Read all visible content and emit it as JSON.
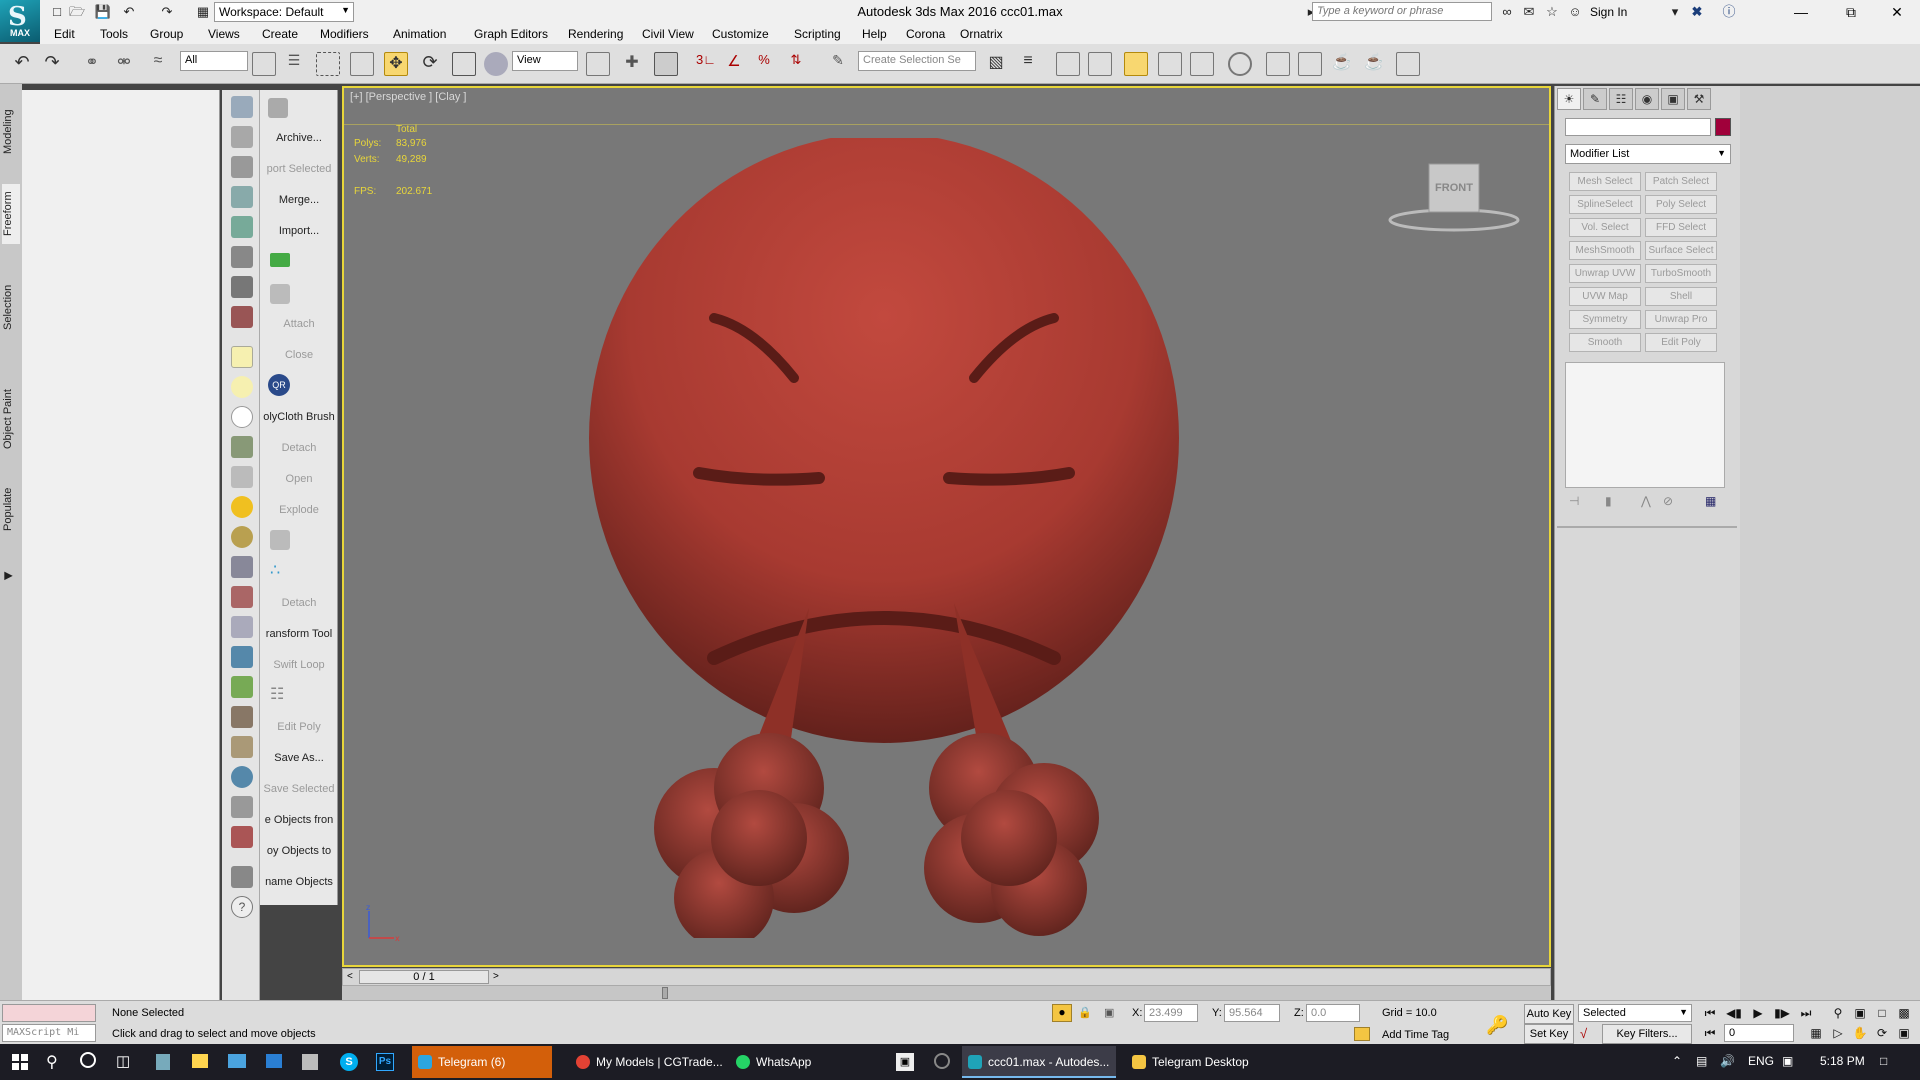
{
  "titlebar": {
    "workspace": "Workspace: Default",
    "title": "Autodesk 3ds Max 2016     ccc01.max",
    "search_placeholder": "Type a keyword or phrase",
    "sign_in": "Sign In",
    "logo_text": "MAX"
  },
  "menubar": [
    "Edit",
    "Tools",
    "Group",
    "Views",
    "Create",
    "Modifiers",
    "Animation",
    "Graph Editors",
    "Rendering",
    "Civil View",
    "Customize",
    "Scripting",
    "Help",
    "Corona",
    "Ornatrix"
  ],
  "toolbar": {
    "selection_filter": "All",
    "ref_coord": "View",
    "selection_set_placeholder": "Create Selection Se"
  },
  "ribbon_tabs": [
    "Modeling",
    "Freeform",
    "Selection",
    "Object Paint",
    "Populate"
  ],
  "left_labels": [
    {
      "text": "Archive...",
      "enabled": true
    },
    {
      "text": "port Selected",
      "enabled": false
    },
    {
      "text": "Merge...",
      "enabled": true
    },
    {
      "text": "Import...",
      "enabled": true
    },
    {
      "text": "Attach",
      "enabled": false
    },
    {
      "text": "Close",
      "enabled": false
    },
    {
      "text": "olyCloth Brush",
      "enabled": true
    },
    {
      "text": "Detach",
      "enabled": false
    },
    {
      "text": "Open",
      "enabled": false
    },
    {
      "text": "Explode",
      "enabled": false
    },
    {
      "text": "Detach",
      "enabled": false
    },
    {
      "text": "ransform Tool",
      "enabled": true
    },
    {
      "text": "Swift Loop",
      "enabled": false
    },
    {
      "text": "Edit Poly",
      "enabled": false
    },
    {
      "text": "Save As...",
      "enabled": true
    },
    {
      "text": "Save Selected",
      "enabled": false
    },
    {
      "text": "e Objects fron",
      "enabled": true
    },
    {
      "text": "oy Objects to",
      "enabled": true
    },
    {
      "text": "name Objects",
      "enabled": true
    }
  ],
  "viewport": {
    "label": "[+] [Perspective ] [Clay ]",
    "stats_header": "Total",
    "polys_label": "Polys:",
    "polys_value": "83,976",
    "verts_label": "Verts:",
    "verts_value": "49,289",
    "fps_label": "FPS:",
    "fps_value": "202.671",
    "viewcube_face": "FRONT"
  },
  "command_panel": {
    "modifier_list": "Modifier List",
    "buttons": [
      "Mesh Select",
      "Patch Select",
      "SplineSelect",
      "Poly Select",
      "Vol. Select",
      "FFD Select",
      "MeshSmooth",
      "Surface Select",
      "Unwrap UVW",
      "TurboSmooth",
      "UVW Map",
      "Shell",
      "Symmetry",
      "Unwrap Pro",
      "Smooth",
      "Edit Poly"
    ]
  },
  "timeslider": {
    "frame": "0 / 1"
  },
  "statusbar": {
    "selection": "None Selected",
    "prompt": "Click and drag to select and move objects",
    "maxscript": "MAXScript Mi",
    "x_label": "X:",
    "x_value": "23.499",
    "y_label": "Y:",
    "y_value": "95.564",
    "z_label": "Z:",
    "z_value": "0.0",
    "grid": "Grid = 10.0",
    "add_time_tag": "Add Time Tag",
    "auto_key": "Auto Key",
    "set_key": "Set Key",
    "key_mode": "Selected",
    "key_filters": "Key Filters...",
    "frame_value": "0"
  },
  "taskbar": {
    "apps": [
      {
        "label": "Telegram (6)",
        "color": "#2ca5e0",
        "state": "hl"
      },
      {
        "label": "My Models | CGTrade...",
        "color": "#e34234",
        "state": ""
      },
      {
        "label": "WhatsApp",
        "color": "#25d366",
        "state": ""
      },
      {
        "label": "ccc01.max - Autodes...",
        "color": "#1fa3b8",
        "state": "active"
      },
      {
        "label": "Telegram Desktop",
        "color": "#f4c542",
        "state": ""
      }
    ],
    "lang": "ENG",
    "time": "5:18 PM"
  }
}
